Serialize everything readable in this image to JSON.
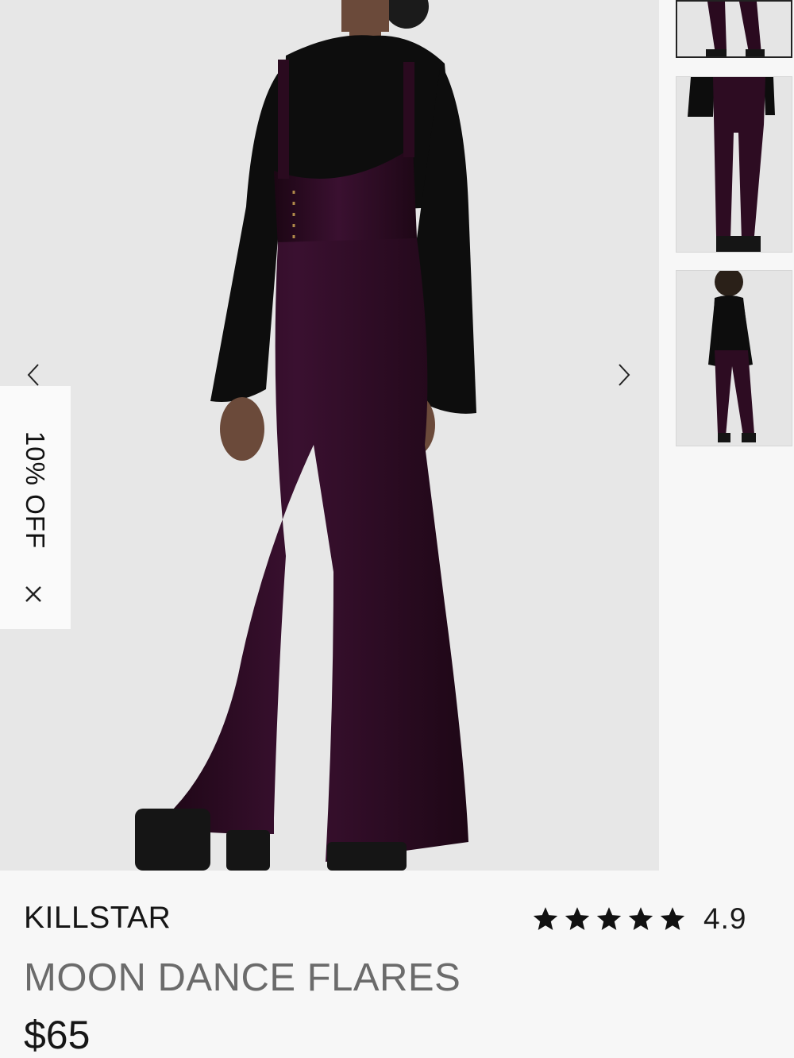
{
  "product": {
    "brand": "KILLSTAR",
    "name": "MOON DANCE FLARES",
    "price": "$65",
    "rating": {
      "value": "4.9",
      "stars_filled": 5,
      "stars_total": 5
    }
  },
  "promo": {
    "label": "10% OFF",
    "close_glyph": "×"
  },
  "gallery": {
    "prev_glyph": "‹",
    "next_glyph": "›",
    "thumbnails": [
      {
        "view": "front-legs",
        "active": true
      },
      {
        "view": "back",
        "active": false
      },
      {
        "view": "back-full",
        "active": false
      }
    ]
  },
  "colors": {
    "garment": "#2d0c22",
    "shirt": "#0d0d0d",
    "background": "#e7e7e7",
    "page": "#f7f7f7"
  },
  "icons": {
    "prev": "chevron-left-icon",
    "next": "chevron-right-icon",
    "close": "close-icon",
    "star": "star-icon"
  }
}
